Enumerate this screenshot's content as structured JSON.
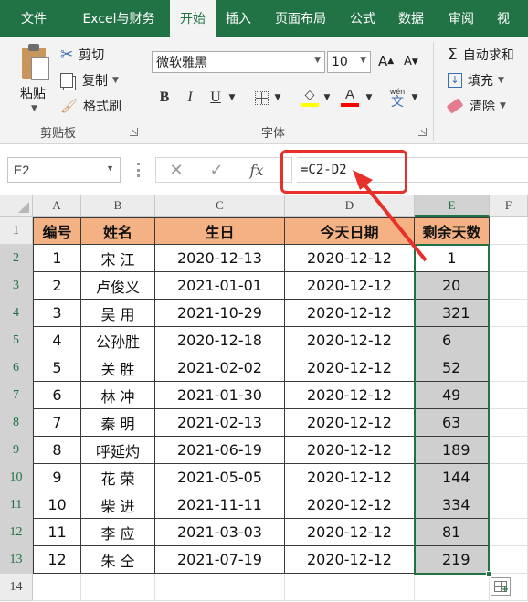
{
  "tabs": [
    "文件",
    "Excel与财务",
    "开始",
    "插入",
    "页面布局",
    "公式",
    "数据",
    "审阅",
    "视"
  ],
  "active_tab": "开始",
  "clipboard": {
    "paste": "粘贴",
    "cut": "剪切",
    "copy": "复制",
    "format_painter": "格式刷",
    "group_label": "剪贴板"
  },
  "font": {
    "name": "微软雅黑",
    "size": "10",
    "group_label": "字体",
    "bold": "B",
    "italic": "I",
    "underline": "U",
    "wen": "wén"
  },
  "editing": {
    "autosum": "自动求和",
    "fill": "填充",
    "clear": "清除"
  },
  "formula_bar": {
    "name_box": "E2",
    "formula": "=C2-D2"
  },
  "columns": [
    "A",
    "B",
    "C",
    "D",
    "E",
    "F"
  ],
  "headers": [
    "编号",
    "姓名",
    "生日",
    "今天日期",
    "剩余天数"
  ],
  "rows": [
    [
      "1",
      "宋 江",
      "2020-12-13",
      "2020-12-12",
      "1"
    ],
    [
      "2",
      "卢俊义",
      "2021-01-01",
      "2020-12-12",
      "20"
    ],
    [
      "3",
      "吴 用",
      "2021-10-29",
      "2020-12-12",
      "321"
    ],
    [
      "4",
      "公孙胜",
      "2020-12-18",
      "2020-12-12",
      "6"
    ],
    [
      "5",
      "关 胜",
      "2021-02-02",
      "2020-12-12",
      "52"
    ],
    [
      "6",
      "林 冲",
      "2021-01-30",
      "2020-12-12",
      "49"
    ],
    [
      "7",
      "秦 明",
      "2021-02-13",
      "2020-12-12",
      "63"
    ],
    [
      "8",
      "呼延灼",
      "2021-06-19",
      "2020-12-12",
      "189"
    ],
    [
      "9",
      "花 荣",
      "2021-05-05",
      "2020-12-12",
      "144"
    ],
    [
      "10",
      "柴 进",
      "2021-11-11",
      "2020-12-12",
      "334"
    ],
    [
      "11",
      "李 应",
      "2021-03-03",
      "2020-12-12",
      "81"
    ],
    [
      "12",
      "朱 仝",
      "2021-07-19",
      "2020-12-12",
      "219"
    ]
  ],
  "row_numbers": [
    "1",
    "2",
    "3",
    "4",
    "5",
    "6",
    "7",
    "8",
    "9",
    "10",
    "11",
    "12",
    "13",
    "14"
  ],
  "colors": {
    "ribbon_green": "#217346",
    "header_fill": "#f4b183",
    "selected_fill": "#cfcfcf",
    "annotation_red": "#e8302b"
  }
}
